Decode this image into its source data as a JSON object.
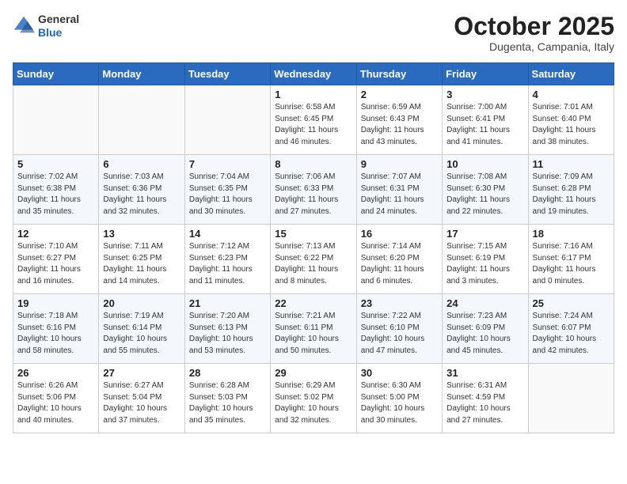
{
  "header": {
    "logo_general": "General",
    "logo_blue": "Blue",
    "month_title": "October 2025",
    "subtitle": "Dugenta, Campania, Italy"
  },
  "weekdays": [
    "Sunday",
    "Monday",
    "Tuesday",
    "Wednesday",
    "Thursday",
    "Friday",
    "Saturday"
  ],
  "weeks": [
    [
      {
        "day": "",
        "info": ""
      },
      {
        "day": "",
        "info": ""
      },
      {
        "day": "",
        "info": ""
      },
      {
        "day": "1",
        "info": "Sunrise: 6:58 AM\nSunset: 6:45 PM\nDaylight: 11 hours\nand 46 minutes."
      },
      {
        "day": "2",
        "info": "Sunrise: 6:59 AM\nSunset: 6:43 PM\nDaylight: 11 hours\nand 43 minutes."
      },
      {
        "day": "3",
        "info": "Sunrise: 7:00 AM\nSunset: 6:41 PM\nDaylight: 11 hours\nand 41 minutes."
      },
      {
        "day": "4",
        "info": "Sunrise: 7:01 AM\nSunset: 6:40 PM\nDaylight: 11 hours\nand 38 minutes."
      }
    ],
    [
      {
        "day": "5",
        "info": "Sunrise: 7:02 AM\nSunset: 6:38 PM\nDaylight: 11 hours\nand 35 minutes."
      },
      {
        "day": "6",
        "info": "Sunrise: 7:03 AM\nSunset: 6:36 PM\nDaylight: 11 hours\nand 32 minutes."
      },
      {
        "day": "7",
        "info": "Sunrise: 7:04 AM\nSunset: 6:35 PM\nDaylight: 11 hours\nand 30 minutes."
      },
      {
        "day": "8",
        "info": "Sunrise: 7:06 AM\nSunset: 6:33 PM\nDaylight: 11 hours\nand 27 minutes."
      },
      {
        "day": "9",
        "info": "Sunrise: 7:07 AM\nSunset: 6:31 PM\nDaylight: 11 hours\nand 24 minutes."
      },
      {
        "day": "10",
        "info": "Sunrise: 7:08 AM\nSunset: 6:30 PM\nDaylight: 11 hours\nand 22 minutes."
      },
      {
        "day": "11",
        "info": "Sunrise: 7:09 AM\nSunset: 6:28 PM\nDaylight: 11 hours\nand 19 minutes."
      }
    ],
    [
      {
        "day": "12",
        "info": "Sunrise: 7:10 AM\nSunset: 6:27 PM\nDaylight: 11 hours\nand 16 minutes."
      },
      {
        "day": "13",
        "info": "Sunrise: 7:11 AM\nSunset: 6:25 PM\nDaylight: 11 hours\nand 14 minutes."
      },
      {
        "day": "14",
        "info": "Sunrise: 7:12 AM\nSunset: 6:23 PM\nDaylight: 11 hours\nand 11 minutes."
      },
      {
        "day": "15",
        "info": "Sunrise: 7:13 AM\nSunset: 6:22 PM\nDaylight: 11 hours\nand 8 minutes."
      },
      {
        "day": "16",
        "info": "Sunrise: 7:14 AM\nSunset: 6:20 PM\nDaylight: 11 hours\nand 6 minutes."
      },
      {
        "day": "17",
        "info": "Sunrise: 7:15 AM\nSunset: 6:19 PM\nDaylight: 11 hours\nand 3 minutes."
      },
      {
        "day": "18",
        "info": "Sunrise: 7:16 AM\nSunset: 6:17 PM\nDaylight: 11 hours\nand 0 minutes."
      }
    ],
    [
      {
        "day": "19",
        "info": "Sunrise: 7:18 AM\nSunset: 6:16 PM\nDaylight: 10 hours\nand 58 minutes."
      },
      {
        "day": "20",
        "info": "Sunrise: 7:19 AM\nSunset: 6:14 PM\nDaylight: 10 hours\nand 55 minutes."
      },
      {
        "day": "21",
        "info": "Sunrise: 7:20 AM\nSunset: 6:13 PM\nDaylight: 10 hours\nand 53 minutes."
      },
      {
        "day": "22",
        "info": "Sunrise: 7:21 AM\nSunset: 6:11 PM\nDaylight: 10 hours\nand 50 minutes."
      },
      {
        "day": "23",
        "info": "Sunrise: 7:22 AM\nSunset: 6:10 PM\nDaylight: 10 hours\nand 47 minutes."
      },
      {
        "day": "24",
        "info": "Sunrise: 7:23 AM\nSunset: 6:09 PM\nDaylight: 10 hours\nand 45 minutes."
      },
      {
        "day": "25",
        "info": "Sunrise: 7:24 AM\nSunset: 6:07 PM\nDaylight: 10 hours\nand 42 minutes."
      }
    ],
    [
      {
        "day": "26",
        "info": "Sunrise: 6:26 AM\nSunset: 5:06 PM\nDaylight: 10 hours\nand 40 minutes."
      },
      {
        "day": "27",
        "info": "Sunrise: 6:27 AM\nSunset: 5:04 PM\nDaylight: 10 hours\nand 37 minutes."
      },
      {
        "day": "28",
        "info": "Sunrise: 6:28 AM\nSunset: 5:03 PM\nDaylight: 10 hours\nand 35 minutes."
      },
      {
        "day": "29",
        "info": "Sunrise: 6:29 AM\nSunset: 5:02 PM\nDaylight: 10 hours\nand 32 minutes."
      },
      {
        "day": "30",
        "info": "Sunrise: 6:30 AM\nSunset: 5:00 PM\nDaylight: 10 hours\nand 30 minutes."
      },
      {
        "day": "31",
        "info": "Sunrise: 6:31 AM\nSunset: 4:59 PM\nDaylight: 10 hours\nand 27 minutes."
      },
      {
        "day": "",
        "info": ""
      }
    ]
  ]
}
